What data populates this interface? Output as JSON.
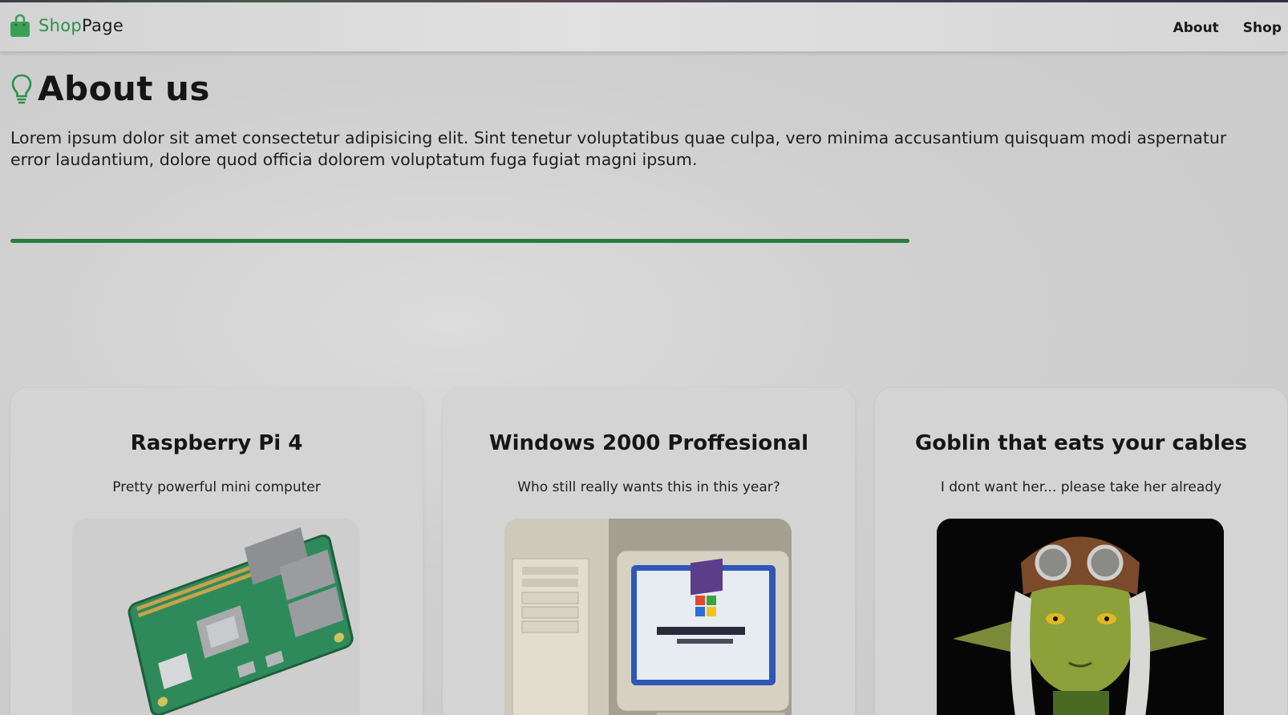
{
  "nav": {
    "brand_shop": "Shop",
    "brand_page": "Page",
    "links": [
      "About",
      "Shop"
    ]
  },
  "about": {
    "title": "About us",
    "body": "Lorem ipsum dolor sit amet consectetur adipisicing elit. Sint tenetur voluptatibus quae culpa, vero minima accusantium quisquam modi aspernatur error laudantium, dolore quod officia dolorem voluptatum fuga fugiat magni ipsum."
  },
  "products": [
    {
      "title": "Raspberry Pi 4",
      "description": "Pretty powerful mini computer",
      "image": "raspberry-pi-board"
    },
    {
      "title": "Windows 2000 Proffesional",
      "description": "Who still really wants this in this year?",
      "image": "windows-2000-computer"
    },
    {
      "title": "Goblin that eats your cables",
      "description": "I dont want her... please take her already",
      "image": "goblin-figure"
    }
  ],
  "colors": {
    "accent": "#2f8f4a",
    "divider": "#2d7a3e",
    "background": "#cfcfcf"
  }
}
